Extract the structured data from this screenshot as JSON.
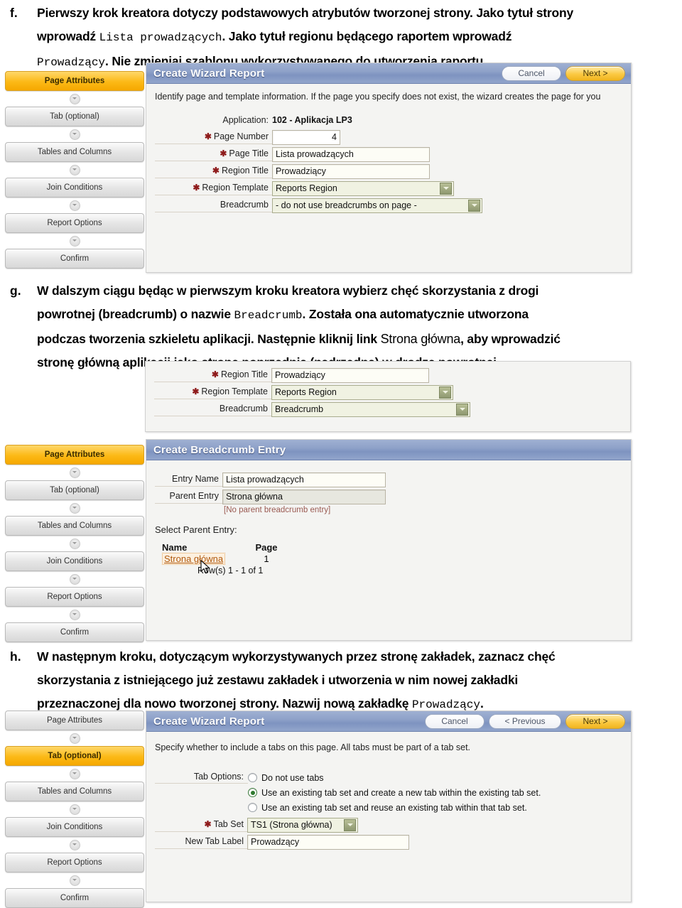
{
  "document": {
    "paragraphs": [
      {
        "marker": "f.",
        "lines": [
          [
            {
              "t": "Pierwszy krok kreatora dotyczy podstawowych atrybutów tworzonej strony. Jako tytuł strony",
              "m": false
            }
          ],
          [
            {
              "t": "wprowadź ",
              "m": false
            },
            {
              "t": "Lista prowadzących",
              "m": true
            },
            {
              "t": ". Jako tytuł regionu będącego raportem wprowadź",
              "m": false
            }
          ],
          [
            {
              "t": "Prowadzący",
              "m": true
            },
            {
              "t": ". Nie zmieniaj szablonu wykorzystywanego do utworzenia raportu.",
              "m": false
            }
          ]
        ]
      },
      {
        "marker": "g.",
        "lines": [
          [
            {
              "t": "W dalszym ciągu będąc w pierwszym kroku kreatora wybierz chęć skorzystania z drogi",
              "m": false
            }
          ],
          [
            {
              "t": "powrotnej (breadcrumb) o nazwie ",
              "m": false
            },
            {
              "t": "Breadcrumb",
              "m": true
            },
            {
              "t": ". Została ona automatycznie utworzona",
              "m": false
            }
          ],
          [
            {
              "t": "podczas tworzenia szkieletu aplikacji. Następnie kliknij link ",
              "m": false
            },
            {
              "t": "Strona główna",
              "m": false,
              "big": true
            },
            {
              "t": ", aby wprowadzić",
              "m": false
            }
          ],
          [
            {
              "t": "stronę główną aplikacji jako stronę poprzednią (nadrzędną) w drodze powrotnej.",
              "m": false
            }
          ]
        ]
      },
      {
        "marker": "h.",
        "lines": [
          [
            {
              "t": "W następnym kroku, dotyczącym wykorzystywanych przez stronę zakładek, zaznacz chęć",
              "m": false
            }
          ],
          [
            {
              "t": "skorzystania z istniejącego już zestawu zakładek i utworzenia w nim nowej zakładki",
              "m": false
            }
          ],
          [
            {
              "t": "przeznaczonej dla nowo tworzonej strony. Nazwij nową zakładkę ",
              "m": false
            },
            {
              "t": "Prowadzący",
              "m": true
            },
            {
              "t": ".",
              "m": false
            }
          ]
        ]
      }
    ]
  },
  "rail_items": [
    "Page Attributes",
    "Tab (optional)",
    "Tables and Columns",
    "Join Conditions",
    "Report Options",
    "Confirm"
  ],
  "shot1": {
    "active_rail": "Page Attributes",
    "title": "Create Wizard Report",
    "buttons": {
      "cancel": "Cancel",
      "next": "Next >"
    },
    "description": "Identify page and template information. If the page you specify does not exist, the wizard creates the page for you",
    "application_label": "Application:",
    "application_value": "102 - Aplikacja LP3",
    "fields": [
      {
        "label": "Page Number",
        "required": true,
        "value": "4",
        "type": "number"
      },
      {
        "label": "Page Title",
        "required": true,
        "value": "Lista prowadzących",
        "type": "text"
      },
      {
        "label": "Region Title",
        "required": true,
        "value": "Prowadziący",
        "type": "text"
      },
      {
        "label": "Region Template",
        "required": true,
        "value": "Reports Region",
        "type": "select"
      },
      {
        "label": "Breadcrumb",
        "required": false,
        "value": "- do not use breadcrumbs on page -",
        "type": "select"
      }
    ]
  },
  "shot2": {
    "fields": [
      {
        "label": "Region Title",
        "required": true,
        "value": "Prowadziący",
        "type": "text"
      },
      {
        "label": "Region Template",
        "required": true,
        "value": "Reports Region",
        "type": "select"
      },
      {
        "label": "Breadcrumb",
        "required": false,
        "value": "Breadcrumb",
        "type": "select"
      }
    ]
  },
  "shot3": {
    "active_rail": "Page Attributes",
    "title": "Create Breadcrumb Entry",
    "entry_name_label": "Entry Name",
    "entry_name_value": "Lista prowadzących",
    "parent_entry_label": "Parent Entry",
    "parent_entry_value": "Strona główna",
    "parent_note": "[No parent breadcrumb entry]",
    "select_parent_label": "Select Parent Entry:",
    "table": {
      "columns": [
        "Name",
        "Page"
      ],
      "rows": [
        {
          "name": "Strona główna",
          "page": "1"
        }
      ],
      "rowcount": "Row(s) 1 - 1 of 1"
    }
  },
  "shot4": {
    "active_rail": "Tab (optional)",
    "title": "Create Wizard Report",
    "buttons": {
      "cancel": "Cancel",
      "previous": "< Previous",
      "next": "Next >"
    },
    "description": "Specify whether to include a tabs on this page. All tabs must be part of a tab set.",
    "tab_options_label": "Tab Options:",
    "options": [
      {
        "label": "Do not use tabs",
        "selected": false
      },
      {
        "label": "Use an existing tab set and create a new tab within the existing tab set.",
        "selected": true
      },
      {
        "label": "Use an existing tab set and reuse an existing tab within that tab set.",
        "selected": false
      }
    ],
    "fields": [
      {
        "label": "Tab Set",
        "required": true,
        "value": "TS1 (Strona główna)",
        "type": "select"
      },
      {
        "label": "New Tab Label",
        "required": false,
        "value": "Prowadzący",
        "type": "text"
      }
    ]
  },
  "colors": {
    "header_blue": "#8fa2c9",
    "accent_orange": "#fcb916",
    "link_orange": "#b05a10",
    "required_red": "#8e1b1b",
    "select_green": "#8e9870"
  }
}
